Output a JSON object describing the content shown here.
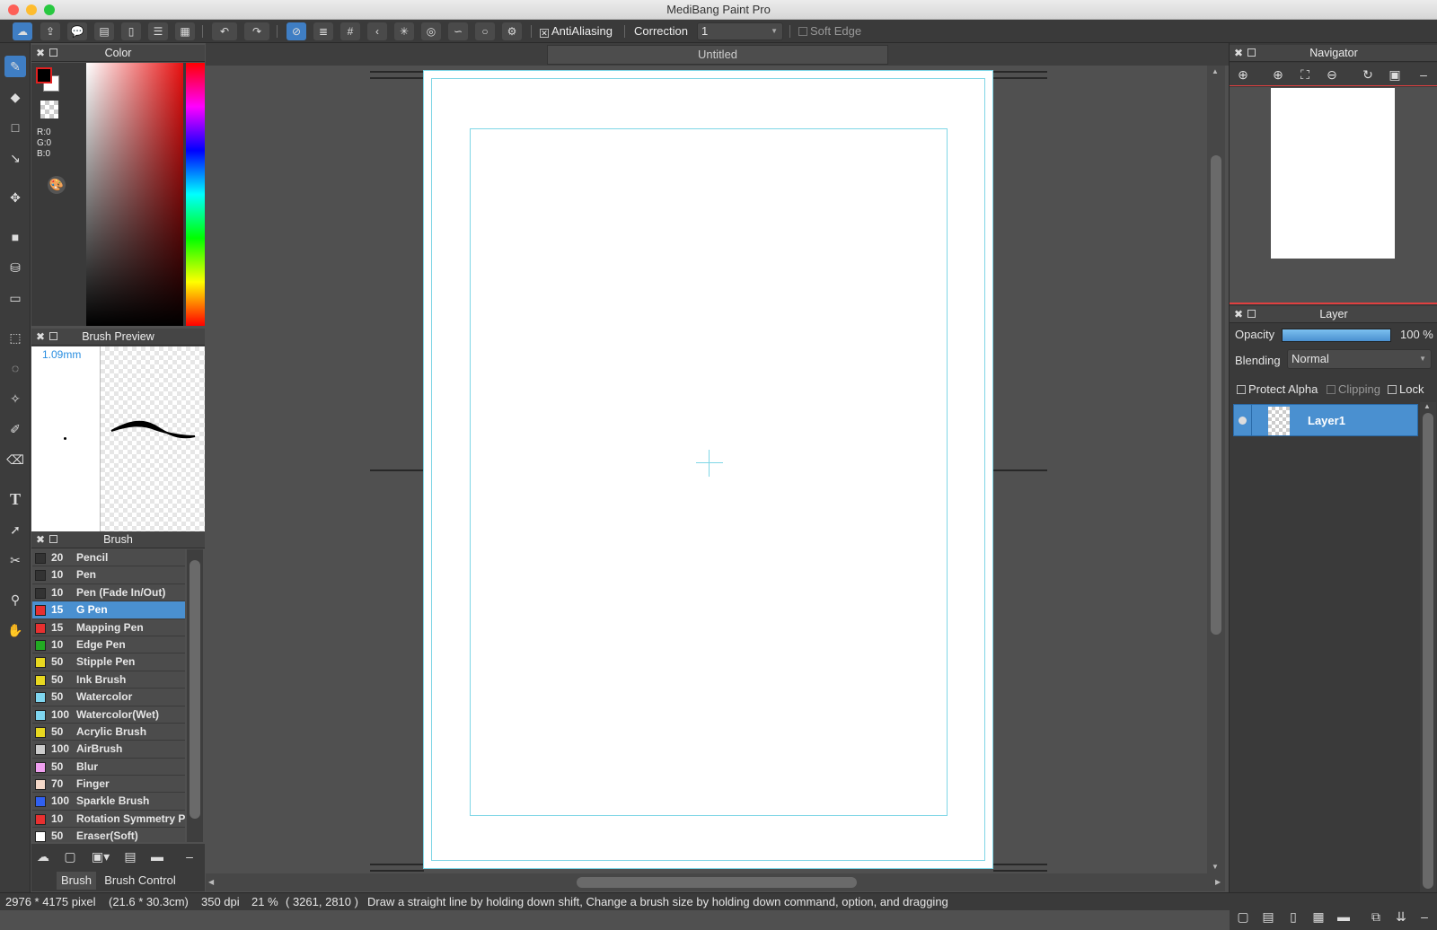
{
  "app": {
    "title": "MediBang Paint Pro"
  },
  "toolbar": {
    "antialias_label": "AntiAliasing",
    "correction_label": "Correction",
    "correction_value": "1",
    "soft_edge_label": "Soft Edge"
  },
  "document": {
    "tab_title": "Untitled"
  },
  "color_panel": {
    "title": "Color",
    "r": "R:0",
    "g": "G:0",
    "b": "B:0",
    "fg_color": "#000000",
    "bg_color": "#ffffff"
  },
  "brush_preview": {
    "title": "Brush Preview",
    "size": "1.09mm"
  },
  "brush_panel": {
    "title": "Brush",
    "items": [
      {
        "size": "20",
        "name": "Pencil",
        "color": "#333333"
      },
      {
        "size": "10",
        "name": "Pen",
        "color": "#333333"
      },
      {
        "size": "10",
        "name": "Pen (Fade In/Out)",
        "color": "#333333"
      },
      {
        "size": "15",
        "name": "G Pen",
        "color": "#e83030",
        "selected": true
      },
      {
        "size": "15",
        "name": "Mapping Pen",
        "color": "#e83030"
      },
      {
        "size": "10",
        "name": "Edge Pen",
        "color": "#22aa22"
      },
      {
        "size": "50",
        "name": "Stipple Pen",
        "color": "#e8d820"
      },
      {
        "size": "50",
        "name": "Ink Brush",
        "color": "#e8d820"
      },
      {
        "size": "50",
        "name": "Watercolor",
        "color": "#7fd6f0"
      },
      {
        "size": "100",
        "name": "Watercolor(Wet)",
        "color": "#7fd6f0"
      },
      {
        "size": "50",
        "name": "Acrylic Brush",
        "color": "#e8d820"
      },
      {
        "size": "100",
        "name": "AirBrush",
        "color": "#cccccc"
      },
      {
        "size": "50",
        "name": "Blur",
        "color": "#f0a0f0"
      },
      {
        "size": "70",
        "name": "Finger",
        "color": "#f4d8c8"
      },
      {
        "size": "100",
        "name": "Sparkle Brush",
        "color": "#3060f0"
      },
      {
        "size": "10",
        "name": "Rotation Symmetry Pe",
        "color": "#e83030"
      },
      {
        "size": "50",
        "name": "Eraser(Soft)",
        "color": "#ffffff"
      }
    ],
    "tab_brush": "Brush",
    "tab_brush_control": "Brush Control"
  },
  "navigator": {
    "title": "Navigator"
  },
  "layer_panel": {
    "title": "Layer",
    "opacity_label": "Opacity",
    "opacity_value": "100 %",
    "opacity_fraction": 1.0,
    "blending_label": "Blending",
    "blending_value": "Normal",
    "protect_alpha_label": "Protect Alpha",
    "clipping_label": "Clipping",
    "lock_label": "Lock",
    "layers": [
      {
        "name": "Layer1"
      }
    ]
  },
  "status": {
    "pixels": "2976 * 4175 pixel",
    "size": "(21.6 * 30.3cm)",
    "dpi": "350 dpi",
    "zoom": "21 %",
    "coords": "( 3261, 2810 )",
    "hint": "Draw a straight line by holding down shift, Change a brush size by holding down command, option, and dragging"
  },
  "colors": {
    "accent": "#4a90d0",
    "guide": "#7fd6e6"
  }
}
